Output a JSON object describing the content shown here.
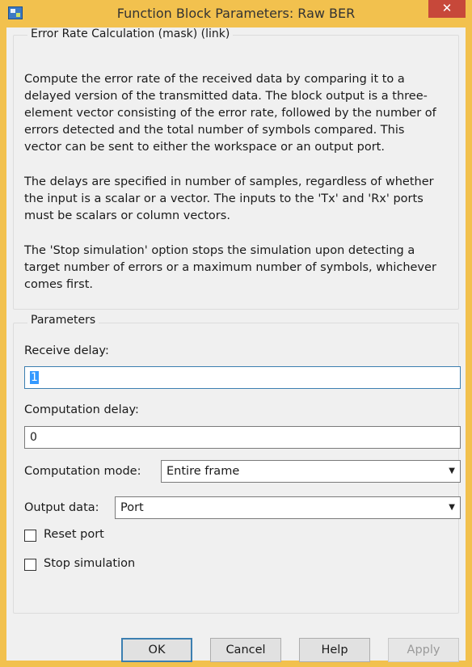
{
  "window": {
    "title": "Function Block Parameters: Raw BER",
    "close_glyph": "✕"
  },
  "mask": {
    "group_title": "Error Rate Calculation (mask) (link)",
    "paragraphs": [
      "Compute the error rate of the received data by comparing it to a delayed version of the transmitted data. The block output is a three-element vector consisting of the error rate, followed by the number of errors detected and the total number of symbols compared. This vector can be sent to either the workspace or an output port.",
      "The delays are specified in number of samples, regardless of whether the input is a scalar or a vector. The inputs to the 'Tx' and 'Rx' ports must be scalars or column vectors.",
      "The 'Stop simulation' option stops the simulation upon detecting a target number of errors or a maximum number of symbols, whichever comes first."
    ]
  },
  "parameters": {
    "group_title": "Parameters",
    "receive_delay_label": "Receive delay:",
    "receive_delay_value": "1",
    "computation_delay_label": "Computation delay:",
    "computation_delay_value": "0",
    "computation_mode_label": "Computation mode:",
    "computation_mode_value": "Entire frame",
    "output_data_label": "Output data:",
    "output_data_value": "Port",
    "reset_port_label": "Reset port",
    "reset_port_checked": false,
    "stop_simulation_label": "Stop simulation",
    "stop_simulation_checked": false
  },
  "buttons": {
    "ok": "OK",
    "cancel": "Cancel",
    "help": "Help",
    "apply": "Apply"
  }
}
